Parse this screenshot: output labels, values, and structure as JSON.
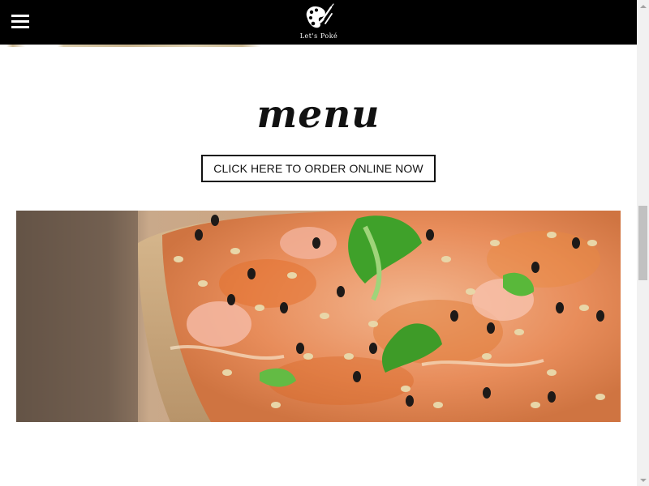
{
  "header": {
    "menu_icon": "hamburger-icon",
    "logo_icon": "palette-paintbrush-logo",
    "logo_text": "Let's Poké",
    "background": "#000000"
  },
  "main": {
    "title": "menu",
    "order_button_label": "CLICK HERE TO ORDER ONLINE NOW",
    "hero_image": "poke-bowl-photo"
  },
  "scrollbar": {
    "up_icon": "scroll-up-arrow-icon",
    "down_icon": "scroll-down-arrow-icon"
  }
}
